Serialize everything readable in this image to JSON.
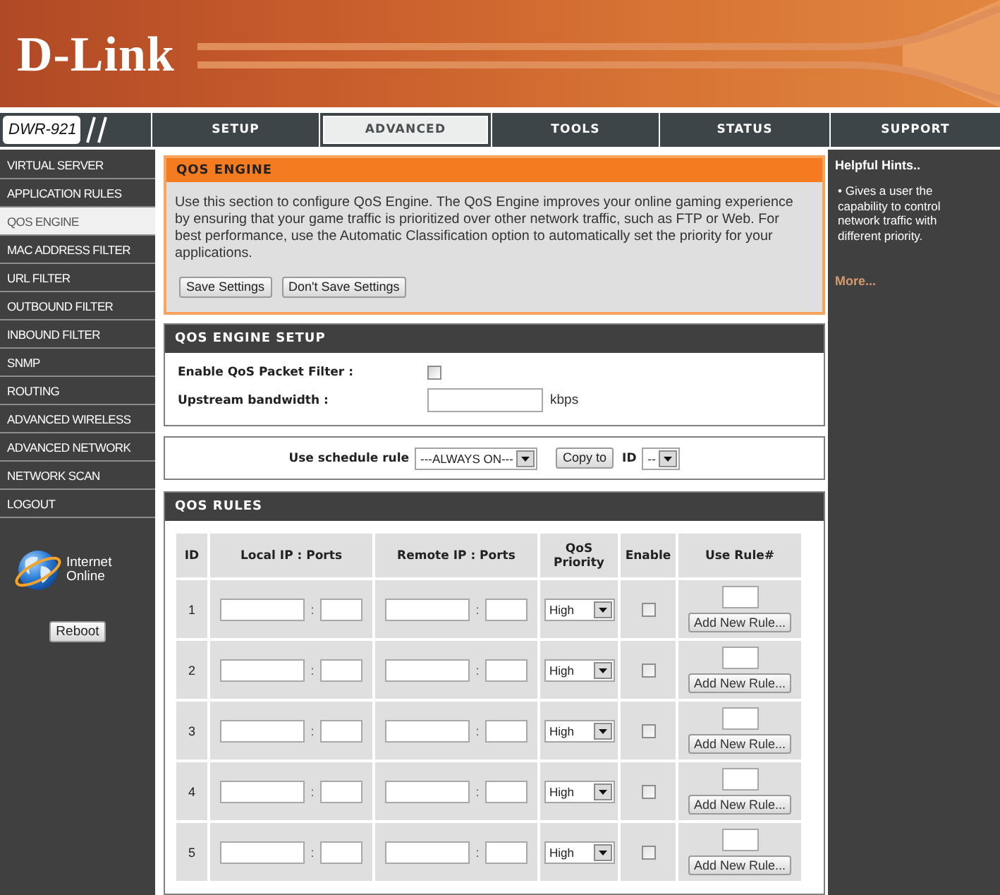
{
  "header": {
    "logo": "D-Link"
  },
  "nav": {
    "model": "DWR-921",
    "tabs": [
      {
        "label": "SETUP",
        "selected": false
      },
      {
        "label": "ADVANCED",
        "selected": true
      },
      {
        "label": "TOOLS",
        "selected": false
      },
      {
        "label": "STATUS",
        "selected": false
      },
      {
        "label": "SUPPORT",
        "selected": false
      }
    ]
  },
  "sidebar": {
    "items": [
      {
        "label": "VIRTUAL SERVER",
        "selected": false
      },
      {
        "label": "APPLICATION RULES",
        "selected": false
      },
      {
        "label": "QOS ENGINE",
        "selected": true
      },
      {
        "label": "MAC ADDRESS FILTER",
        "selected": false
      },
      {
        "label": "URL FILTER",
        "selected": false
      },
      {
        "label": "OUTBOUND FILTER",
        "selected": false
      },
      {
        "label": "INBOUND FILTER",
        "selected": false
      },
      {
        "label": "SNMP",
        "selected": false
      },
      {
        "label": "ROUTING",
        "selected": false
      },
      {
        "label": "ADVANCED WIRELESS",
        "selected": false
      },
      {
        "label": "ADVANCED NETWORK",
        "selected": false
      },
      {
        "label": "NETWORK SCAN",
        "selected": false
      },
      {
        "label": "LOGOUT",
        "selected": false
      }
    ],
    "connection": {
      "label": "Internet",
      "status": "Online"
    },
    "reboot_button": "Reboot"
  },
  "qos_engine": {
    "title": "QOS ENGINE",
    "description": "Use this section to configure QoS Engine. The QoS Engine improves your online gaming experience by ensuring that your game traffic is prioritized over other network traffic, such as FTP or Web. For best performance, use the Automatic Classification option to automatically set the priority for your applications.",
    "buttons": [
      "Save Settings",
      "Don't Save Settings"
    ]
  },
  "qos_engine_setup": {
    "title": "QOS ENGINE SETUP",
    "fields": [
      {
        "kind": "checkbox",
        "label": "Enable QoS Packet Filter :",
        "checked": false
      },
      {
        "kind": "text",
        "label": "Upstream bandwidth :",
        "unit": "kbps"
      }
    ]
  },
  "schedule": {
    "label": "Use schedule rule",
    "rule_value": "---ALWAYS ON---",
    "copy_button": "Copy to",
    "id_label": "ID",
    "id_value": "--"
  },
  "qos_rules": {
    "title": "QOS RULES",
    "columns": [
      "ID",
      "Local IP : Ports",
      "Remote IP : Ports",
      "QoS Priority",
      "Enable",
      "Use Rule#"
    ],
    "rows": [
      {
        "id": "1",
        "local_separator": ":",
        "remote_separator": ":",
        "priority": "High",
        "checked": false,
        "button": "Add New Rule..."
      },
      {
        "id": "2",
        "local_separator": ":",
        "remote_separator": ":",
        "priority": "High",
        "checked": false,
        "button": "Add New Rule..."
      },
      {
        "id": "3",
        "local_separator": ":",
        "remote_separator": ":",
        "priority": "High",
        "checked": false,
        "button": "Add New Rule..."
      },
      {
        "id": "4",
        "local_separator": ":",
        "remote_separator": ":",
        "priority": "High",
        "checked": false,
        "button": "Add New Rule..."
      },
      {
        "id": "5",
        "local_separator": ":",
        "remote_separator": ":",
        "priority": "High",
        "checked": false,
        "button": "Add New Rule..."
      }
    ]
  },
  "hints": {
    "title": "Helpful Hints..",
    "text": "• Gives a user the capability to control network traffic with different priority.",
    "more_link": "More..."
  }
}
